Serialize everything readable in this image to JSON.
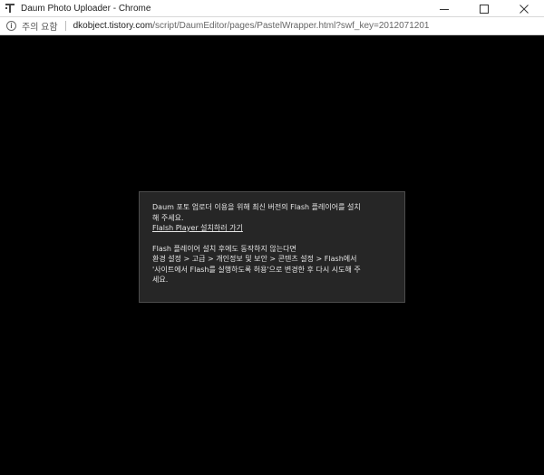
{
  "window": {
    "title": "Daum Photo Uploader - Chrome",
    "controls": [
      "minimize-icon",
      "maximize-icon",
      "close-icon"
    ]
  },
  "address": {
    "security_label": "주의 요함",
    "url_host": "dkobject.tistory.com",
    "url_path": "/script/DaumEditor/pages/PastelWrapper.html?swf_key=2012071201"
  },
  "flash_notice": {
    "line1": "Daum 포토 업로더 이용을 위해 최신 버전의 Flash 플레이어를 설치",
    "line2": "해 주세요.",
    "link": "Flalsh Player 설치하러 가기",
    "line3": "Flash 플레이어 설치 후에도 동작하지 않는다면",
    "line4": "환경 설정 > 고급 > 개인정보 및 보안 > 콘텐츠 설정 > Flash에서",
    "line5": "'사이트에서 Flash를 실행하도록 허용'으로 변경한 후 다시 시도해 주",
    "line6": "세요."
  },
  "colors": {
    "background": "#000000",
    "notice_bg": "#262626",
    "notice_text": "#e6e6e6"
  }
}
